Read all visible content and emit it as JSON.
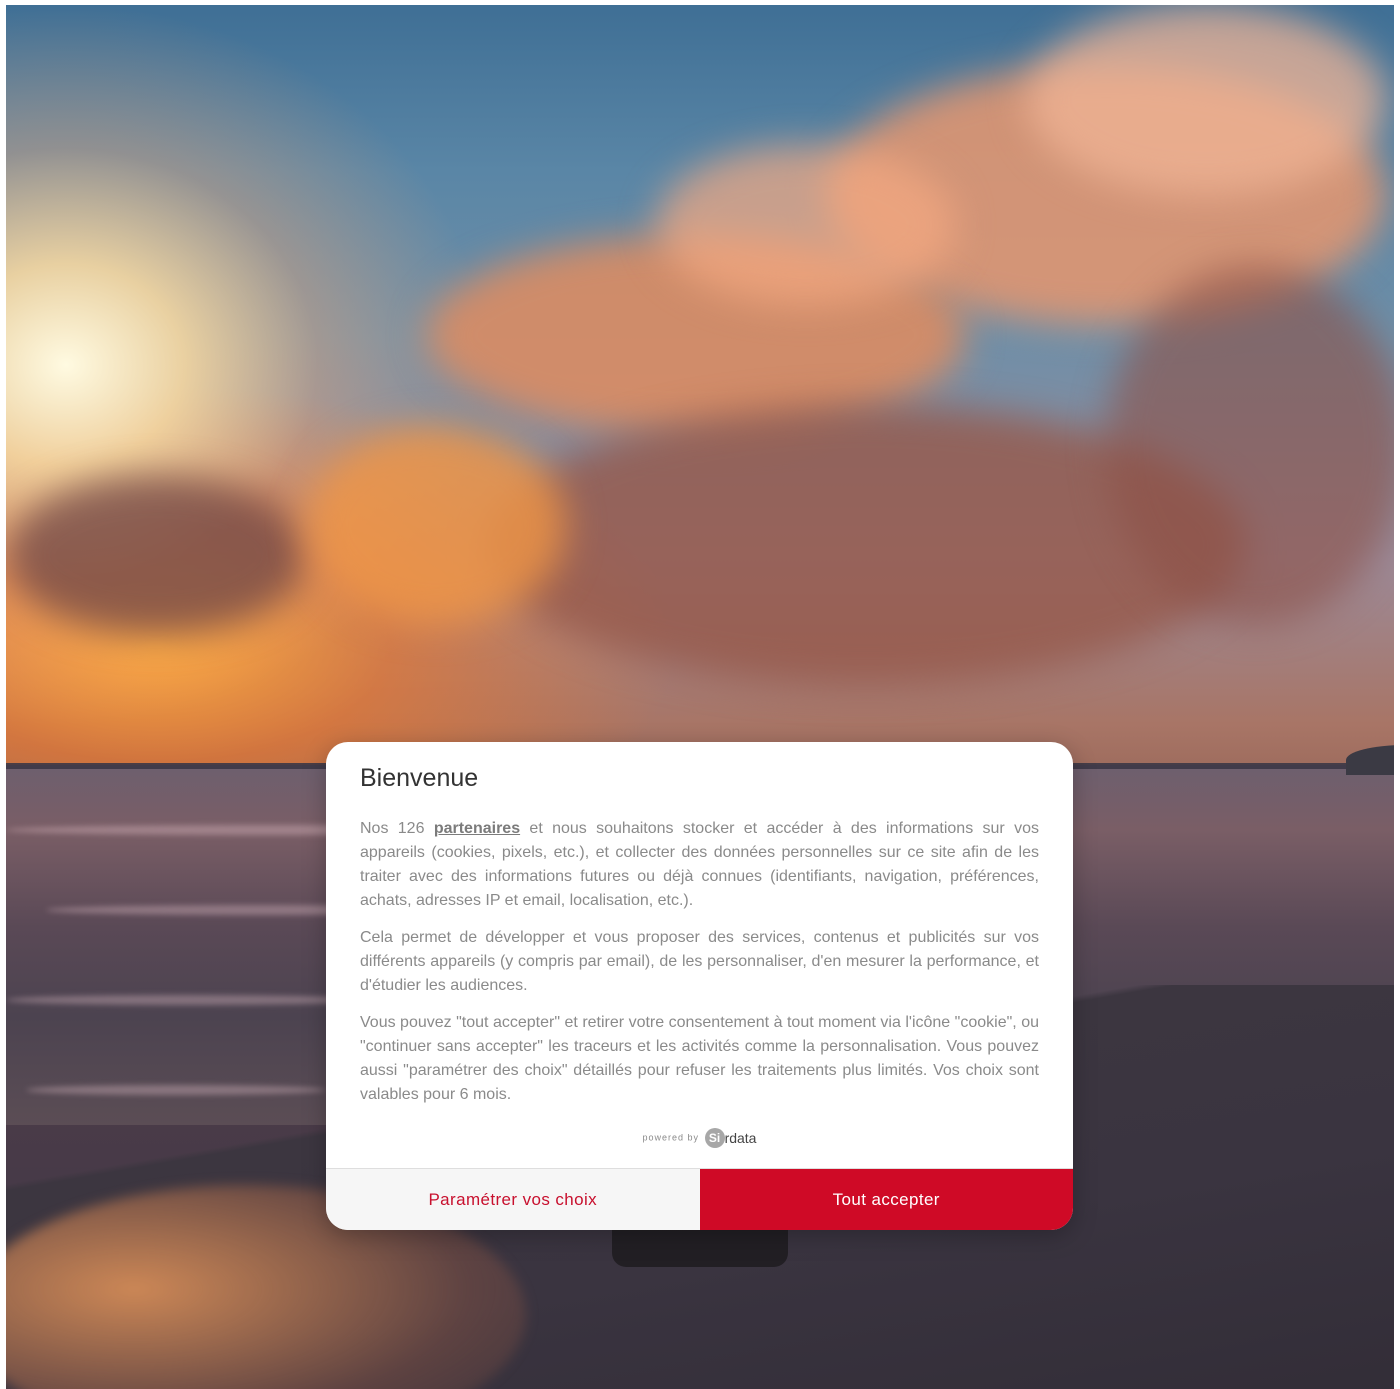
{
  "background": {
    "description_icon": "sunset-beach-photo"
  },
  "consent_modal": {
    "title": "Bienvenue",
    "paragraph1_prefix": "Nos 126 ",
    "partners_link": "partenaires",
    "paragraph1_suffix": " et nous souhaitons stocker et accéder à des informations sur vos appareils (cookies, pixels, etc.), et collecter des données personnelles sur ce site afin de les traiter avec des informations futures ou déjà connues (identifiants, navigation, préférences, achats, adresses IP et email, localisation, etc.).",
    "paragraph2": "Cela permet de développer et vous proposer des services, contenus et publicités sur vos différents appareils (y compris par email), de les personnaliser, d'en mesurer la performance, et d'étudier les audiences.",
    "paragraph3": "Vous pouvez \"tout accepter\" et retirer votre consentement à tout moment via l'icône \"cookie\", ou \"continuer sans accepter\" les traceurs et les activités comme la personnalisation. Vous pouvez aussi \"paramétrer des choix\" détaillés pour refuser les traitements plus limités. Vos choix sont valables pour 6 mois.",
    "powered_by": "powered by",
    "logo_mark": "Si",
    "logo_text": "rdata",
    "btn_settings": "Paramétrer vos choix",
    "btn_accept": "Tout accepter"
  },
  "colors": {
    "accent": "#cf0a26",
    "modal_bg": "#ffffff"
  }
}
